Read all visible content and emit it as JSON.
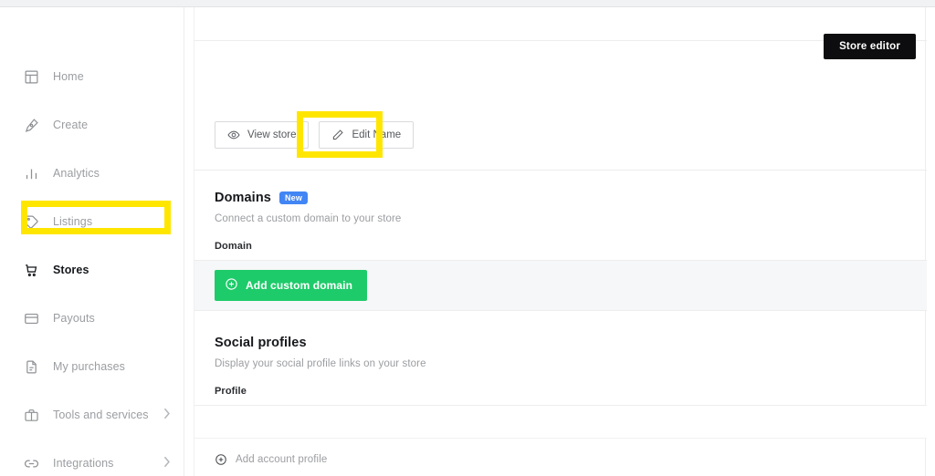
{
  "sidebar": {
    "items": [
      {
        "label": "Home",
        "icon": "layout-icon",
        "active": false,
        "chevron": false
      },
      {
        "label": "Create",
        "icon": "pen-tool-icon",
        "active": false,
        "chevron": false
      },
      {
        "label": "Analytics",
        "icon": "bar-chart-icon",
        "active": false,
        "chevron": false
      },
      {
        "label": "Listings",
        "icon": "tag-icon",
        "active": false,
        "chevron": false
      },
      {
        "label": "Stores",
        "icon": "cart-icon",
        "active": true,
        "chevron": false
      },
      {
        "label": "Payouts",
        "icon": "card-icon",
        "active": false,
        "chevron": false
      },
      {
        "label": "My purchases",
        "icon": "document-icon",
        "active": false,
        "chevron": false
      },
      {
        "label": "Tools and services",
        "icon": "briefcase-icon",
        "active": false,
        "chevron": true
      },
      {
        "label": "Integrations",
        "icon": "link-icon",
        "active": false,
        "chevron": true
      }
    ]
  },
  "header": {
    "store_editor_label": "Store editor"
  },
  "actions": {
    "view_store_label": "View store",
    "view_store_icon": "eye-icon",
    "edit_name_label": "Edit Name",
    "edit_name_icon": "pencil-icon"
  },
  "domains": {
    "title": "Domains",
    "badge": "New",
    "subtitle": "Connect a custom domain to your store",
    "column_header": "Domain",
    "add_button_label": "Add custom domain",
    "add_button_icon": "plus-circle-icon"
  },
  "social": {
    "title": "Social profiles",
    "subtitle": "Display your social profile links on your store",
    "column_header": "Profile",
    "add_link_label": "Add account profile",
    "add_link_icon": "plus-circle-icon"
  },
  "colors": {
    "accent_green": "#1ecb6a",
    "badge_blue": "#4285f4",
    "highlight_yellow": "#ffe600",
    "dark_button": "#0d0d0f"
  }
}
